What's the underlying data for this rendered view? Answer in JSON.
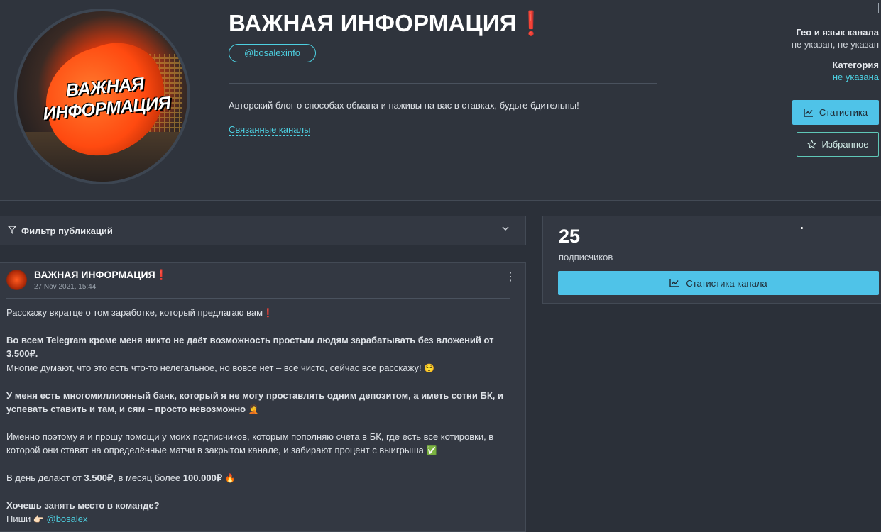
{
  "channel": {
    "title": "ВАЖНАЯ ИНФОРМАЦИЯ",
    "title_mark": "❗",
    "avatar_text_line1": "ВАЖНАЯ",
    "avatar_text_line2": "ИНФОРМАЦИЯ",
    "username": "@bosalexinfo",
    "description": "Авторский блог о способах обмана и наживы на вас в ставках, будьте бдительны!",
    "related_link": "Связанные каналы"
  },
  "meta": {
    "geo_label": "Гео и язык канала",
    "geo_value": "не указан, не указан",
    "category_label": "Категория",
    "category_value": "не указана"
  },
  "buttons": {
    "stats": "Статистика",
    "favorite": "Избранное",
    "channel_stats": "Статистика канала"
  },
  "filter": {
    "label": "Фильтр публикаций"
  },
  "post": {
    "author": "ВАЖНАЯ ИНФОРМАЦИЯ",
    "author_mark": "❗",
    "date": "27 Nov 2021, 15:44",
    "lines": {
      "l1": "Расскажу вкратце о том заработке, который предлагаю вам",
      "l1_mark": "❗",
      "l2": "Во всем Telegram кроме меня никто не даёт возможность простым людям зарабатывать без вложений от 3.500₽.",
      "l3": "Многие думают, что это есть что-то нелегальное, но вовсе нет – все чисто, сейчас все расскажу!",
      "l3_emoji": "😌",
      "l4a": "У меня есть многомиллионный банк, который я не могу проставлять одним депозитом, а иметь сотни БК, и",
      "l4b": "успевать ставить и там, и сям – просто невозможно",
      "l4_emoji": "🤦",
      "l5a": "Именно поэтому я и прошу помощи у моих подписчиков, которым пополняю счета в БК, где есть все котировки, в",
      "l5b": "которой они ставят на определённые матчи в закрытом канале, и забирают процент с выигрыша",
      "l5_emoji": "✅",
      "l6_pre": "В день делают от ",
      "l6_amount1": "3.500₽",
      "l6_mid": ", в месяц более ",
      "l6_amount2": "100.000₽",
      "l6_emoji": "🔥",
      "l7": "Хочешь занять место в команде?",
      "l8_pre": "Пиши",
      "l8_emoji": "👉🏻",
      "l8_link": "@bosalex"
    }
  },
  "stats": {
    "subscribers": "25",
    "subscribers_label": "подписчиков"
  },
  "colors": {
    "accent": "#4fc3e8",
    "link": "#4dd0e1",
    "background": "#2b3039",
    "panel": "#333842"
  }
}
